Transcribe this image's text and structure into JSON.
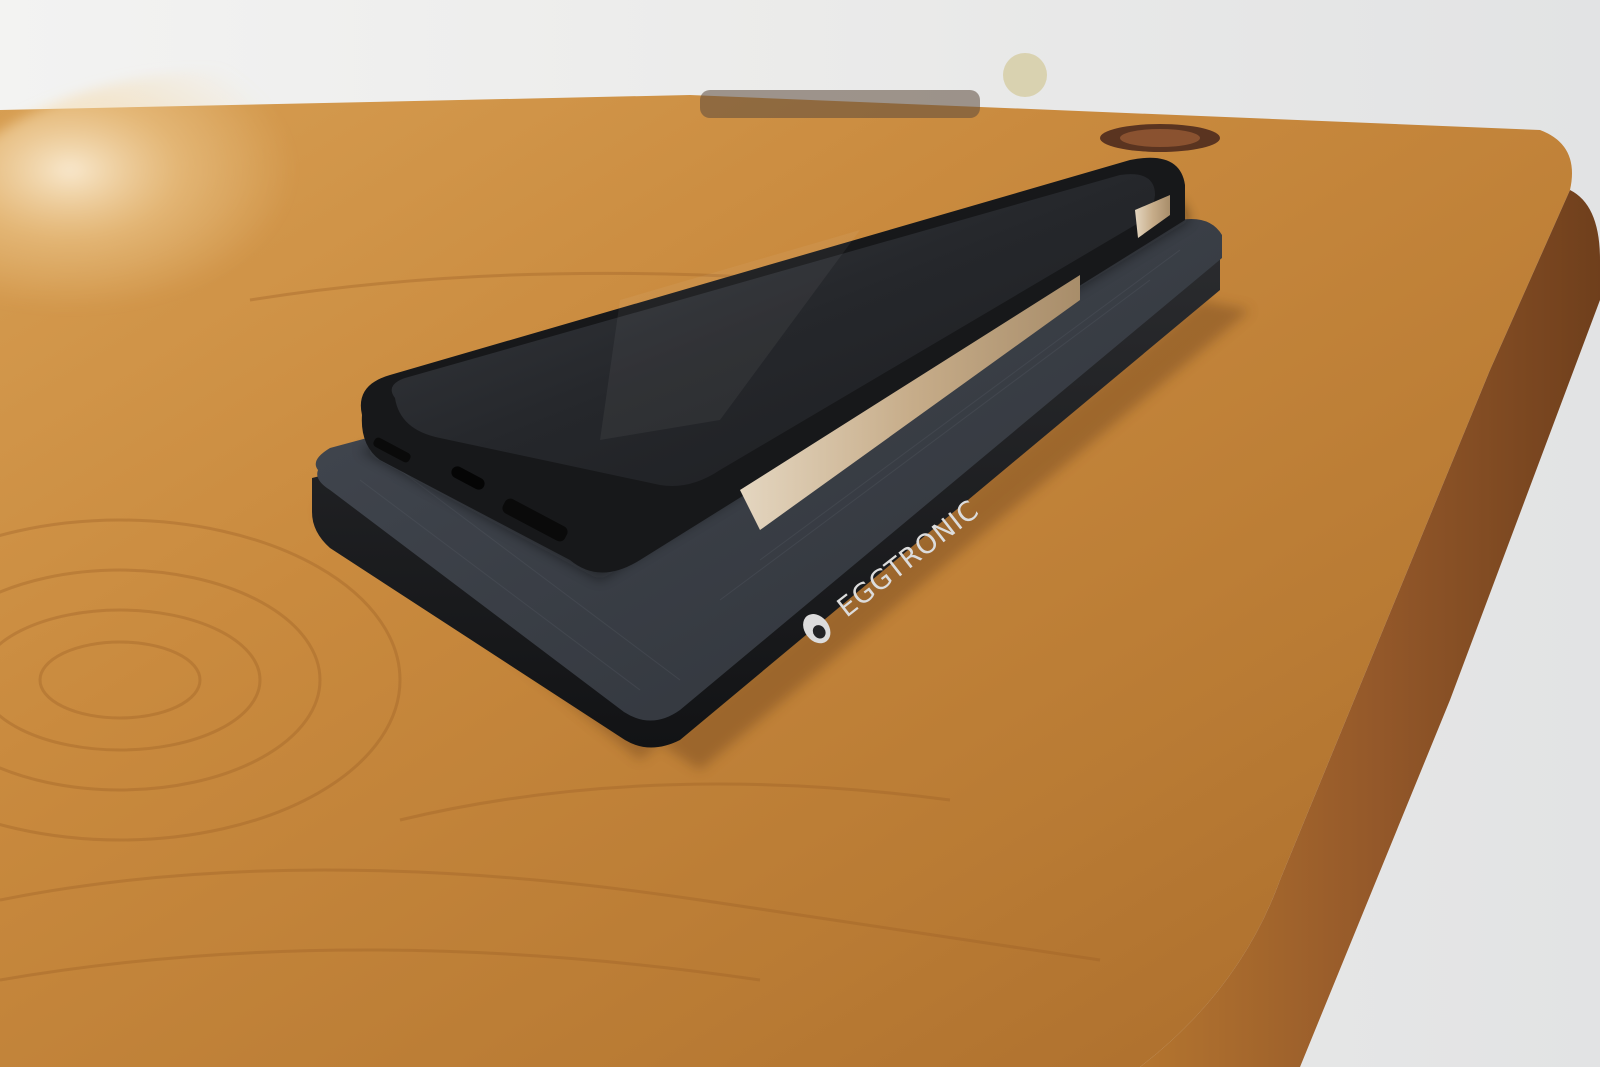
{
  "scene": {
    "description_free": true,
    "charger": {
      "brand_label": "EGGTRONIC",
      "brand_logo_icon": "egg-logo-icon"
    },
    "colors": {
      "wall": "#ececea",
      "wood_light": "#d9a052",
      "wood_mid": "#c0853d",
      "wood_dark": "#8a5524",
      "charger_body": "#1c1d20",
      "charger_fabric": "#3b3f45",
      "phone_case": "#18191b",
      "phone_screen": "#2b2e33",
      "phone_frame_gold": "#cdb89a"
    }
  }
}
